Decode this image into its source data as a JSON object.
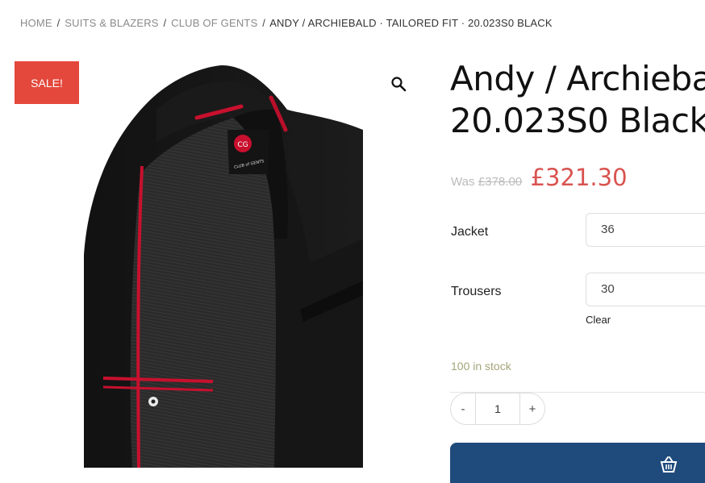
{
  "breadcrumb": {
    "items": [
      "HOME",
      "SUITS & BLAZERS",
      "CLUB OF GENTS"
    ],
    "separator": "/",
    "current": "ANDY / ARCHIEBALD · TAILORED FIT · 20.023S0 BLACK"
  },
  "badge": {
    "sale": "SALE!"
  },
  "product": {
    "title_line1": "Andy / Archieba",
    "title_line2": "20.023S0 Black",
    "was_label": "Was",
    "old_price": "£378.00",
    "price": "£321.30",
    "logo_text": "CG",
    "logo_sub": "CLUB of GENTS"
  },
  "variations": {
    "jacket": {
      "label": "Jacket",
      "value": "36"
    },
    "trousers": {
      "label": "Trousers",
      "value": "30"
    },
    "clear": "Clear"
  },
  "stock": "100 in stock",
  "quantity": {
    "minus": "-",
    "value": "1",
    "plus": "+"
  },
  "icons": {
    "zoom": "magnifier-icon",
    "cart": "basket-icon"
  },
  "colors": {
    "sale": "#e4483c",
    "price": "#d9534f",
    "button": "#1f4a7c",
    "stock": "#a5a57a"
  }
}
